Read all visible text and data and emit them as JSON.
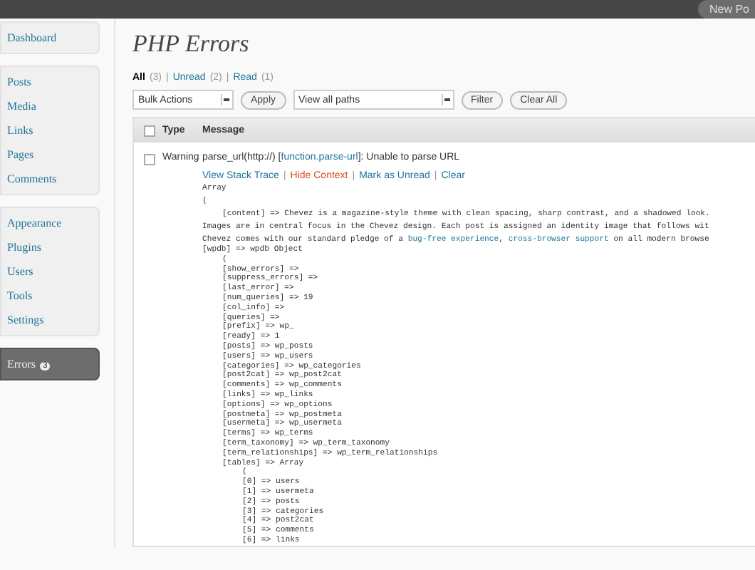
{
  "top_bar": {
    "button": "New Po"
  },
  "sidebar": {
    "groups": [
      [
        {
          "label": "Dashboard",
          "selected": false
        }
      ],
      [
        {
          "label": "Posts",
          "selected": false
        },
        {
          "label": "Media",
          "selected": false
        },
        {
          "label": "Links",
          "selected": false
        },
        {
          "label": "Pages",
          "selected": false
        },
        {
          "label": "Comments",
          "selected": false
        }
      ],
      [
        {
          "label": "Appearance",
          "selected": false
        },
        {
          "label": "Plugins",
          "selected": false
        },
        {
          "label": "Users",
          "selected": false
        },
        {
          "label": "Tools",
          "selected": false
        },
        {
          "label": "Settings",
          "selected": false
        }
      ],
      [
        {
          "label": "Errors",
          "badge": "3",
          "selected": true
        }
      ]
    ]
  },
  "title": "PHP Errors",
  "filters": [
    {
      "label": "All",
      "count": "(3)",
      "selected": true
    },
    {
      "separator": "|",
      "label": "Unread",
      "count": "(2)",
      "selected": false
    },
    {
      "separator": "|",
      "label": "Read",
      "count": "(1)",
      "selected": false
    }
  ],
  "bulk_select": "Bulk Actions",
  "apply_button": "Apply",
  "path_select": "View all paths",
  "filter_button": "Filter",
  "clear_all_button": "Clear All",
  "table": {
    "select_all_checked": false,
    "columns": [
      "Type",
      "Message"
    ],
    "rows": [
      {
        "checked": false,
        "type": "Warning",
        "message": [
          {
            "text": "parse_url(http://) [",
            "kind": "text"
          },
          {
            "text": "function.parse-url",
            "kind": "link"
          },
          {
            "text": "]: Unable to parse URL",
            "kind": "text"
          }
        ],
        "actions": [
          {
            "label": "View Stack Trace",
            "kind": "normal"
          },
          {
            "separator": "|",
            "label": "Hide Context",
            "kind": "danger"
          },
          {
            "separator": "|",
            "label": "Mark as Unread",
            "kind": "normal"
          },
          {
            "separator": "|",
            "label": "Clear",
            "kind": "normal"
          }
        ],
        "context": [
          {
            "text": "Array"
          },
          {
            "text": "("
          },
          {
            "parts": [
              {
                "text": "[content] => Chevez is a magazine-style theme with clean spacing, sharp contrast, and a shadowed look.",
                "kind": "text"
              }
            ]
          },
          {
            "parts": [
              {
                "text": "Images are in central focus in the Chevez design. Each post is assigned an identity image that follows wit",
                "kind": "text"
              }
            ]
          },
          {
            "parts": [
              {
                "text": "Chevez comes with our standard pledge of a ",
                "kind": "text"
              },
              {
                "text": "bug-free experience",
                "kind": "link"
              },
              {
                "text": ", ",
                "kind": "text"
              },
              {
                "text": "cross-browser support",
                "kind": "link"
              },
              {
                "text": " on all modern browse",
                "kind": "text"
              }
            ]
          },
          {
            "text": "[wpdb] => wpdb Object",
            "children": [
              {
                "text": "("
              },
              {
                "text": "[show_errors] =>"
              },
              {
                "text": "[suppress_errors] =>"
              },
              {
                "text": "[last_error] =>"
              },
              {
                "text": "[num_queries] => 19"
              },
              {
                "text": "[col_info] =>"
              },
              {
                "text": "[queries] =>"
              },
              {
                "text": "[prefix] => wp_"
              },
              {
                "text": "[ready] => 1"
              },
              {
                "text": "[posts] => wp_posts"
              },
              {
                "text": "[users] => wp_users"
              },
              {
                "text": "[categories] => wp_categories"
              },
              {
                "text": "[post2cat] => wp_post2cat"
              },
              {
                "text": "[comments] => wp_comments"
              },
              {
                "text": "[links] => wp_links"
              },
              {
                "text": "[options] => wp_options"
              },
              {
                "text": "[postmeta] => wp_postmeta"
              },
              {
                "text": "[usermeta] => wp_usermeta"
              },
              {
                "text": "[terms] => wp_terms"
              },
              {
                "text": "[term_taxonomy] => wp_term_taxonomy"
              },
              {
                "text": "[term_relationships] => wp_term_relationships"
              },
              {
                "text": "[tables] => Array",
                "children": [
                  {
                    "text": "("
                  },
                  {
                    "text": "[0] => users"
                  },
                  {
                    "text": "[1] => usermeta"
                  },
                  {
                    "text": "[2] => posts"
                  },
                  {
                    "text": "[3] => categories"
                  },
                  {
                    "text": "[4] => post2cat"
                  },
                  {
                    "text": "[5] => comments"
                  },
                  {
                    "text": "[6] => links"
                  }
                ]
              }
            ]
          }
        ]
      }
    ]
  }
}
